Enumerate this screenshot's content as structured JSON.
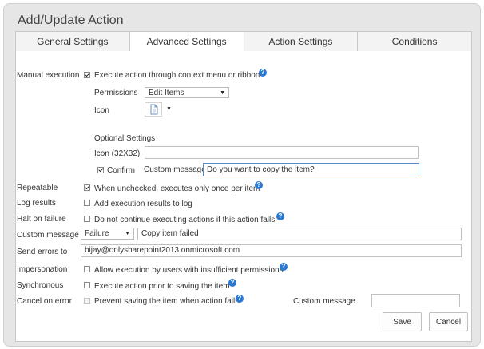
{
  "dialog": {
    "title": "Add/Update Action"
  },
  "tabs": [
    {
      "label": "General Settings"
    },
    {
      "label": "Advanced Settings"
    },
    {
      "label": "Action Settings"
    },
    {
      "label": "Conditions"
    }
  ],
  "manual_execution": {
    "label": "Manual execution",
    "checkbox_text": "Execute action through context menu or ribbon",
    "checked": true,
    "permissions_label": "Permissions",
    "permissions_value": "Edit Items",
    "icon_label": "Icon",
    "optional_settings_label": "Optional Settings",
    "icon32_label": "Icon (32X32)",
    "icon32_value": "",
    "confirm_label": "Confirm",
    "confirm_checked": true,
    "custom_message_label": "Custom message",
    "custom_message_value": "Do you want to copy the item?"
  },
  "repeatable": {
    "label": "Repeatable",
    "text": "When unchecked, executes only once per item",
    "checked": true
  },
  "log_results": {
    "label": "Log results",
    "text": "Add execution results to log",
    "checked": false
  },
  "halt_on_failure": {
    "label": "Halt on failure",
    "text": "Do not continue executing actions if this action fails",
    "checked": false
  },
  "custom_message": {
    "label": "Custom message",
    "type_value": "Failure",
    "message_value": "Copy item failed"
  },
  "send_errors": {
    "label": "Send errors to",
    "value": "bijay@onlysharepoint2013.onmicrosoft.com"
  },
  "impersonation": {
    "label": "Impersonation",
    "text": "Allow execution by users with insufficient permissions",
    "checked": false
  },
  "synchronous": {
    "label": "Synchronous",
    "text": "Execute action prior to saving the item",
    "checked": false
  },
  "cancel_on_error": {
    "label": "Cancel on error",
    "text": "Prevent saving the item when action fails",
    "checked": false,
    "custom_message_label": "Custom message",
    "custom_message_value": ""
  },
  "buttons": {
    "save": "Save",
    "cancel": "Cancel"
  },
  "icons": {
    "help": "help-icon",
    "page": "page-icon",
    "dropdown": "chevron-down-icon"
  },
  "colors": {
    "help_icon": "#2a7ad3",
    "focus_border": "#5b8ec9"
  }
}
